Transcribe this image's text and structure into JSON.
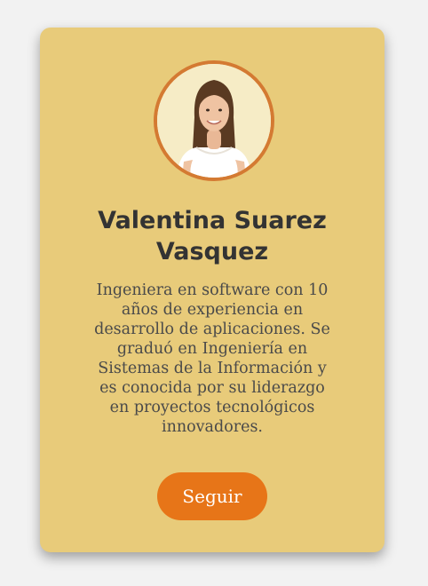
{
  "profile": {
    "name": "Valentina Suarez Vasquez",
    "bio": "Ingeniera en software con 10 años de experiencia en desarrollo de aplicaciones. Se graduó en Ingeniería en Sistemas de la Información y es conocida por su liderazgo en proyectos tecnológicos innovadores.",
    "avatar_icon": "person-photo-icon",
    "follow_label": "Seguir"
  },
  "colors": {
    "page_background": "#f2f2f2",
    "card_background": "#e8cb7a",
    "avatar_border": "#d47a32",
    "button": "#e77518",
    "button_text": "#ffffff",
    "name_text": "#333333"
  }
}
